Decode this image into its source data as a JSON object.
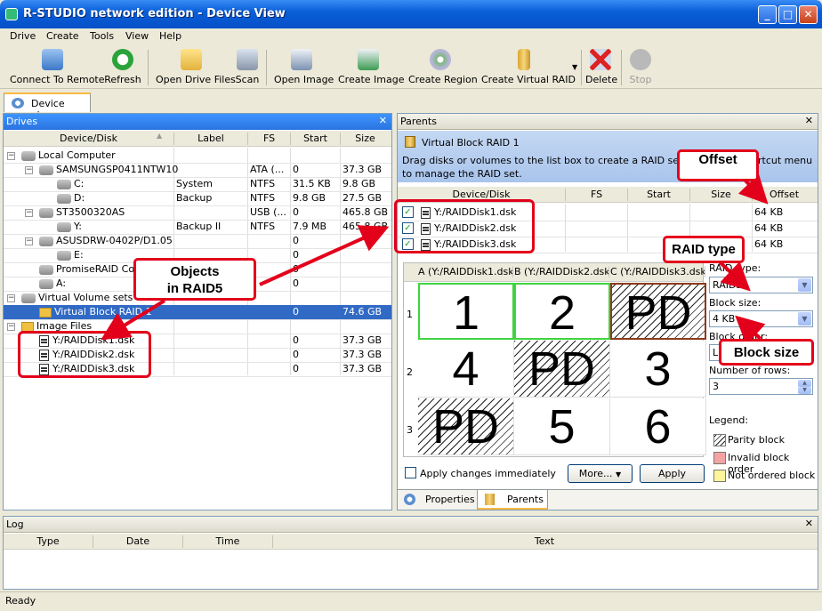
{
  "window": {
    "title": "R-STUDIO network edition - Device View"
  },
  "menu": [
    "Drive",
    "Create",
    "Tools",
    "View",
    "Help"
  ],
  "toolbar": {
    "connect": "Connect To Remote",
    "refresh": "Refresh",
    "open_drive_files": "Open Drive Files",
    "scan": "Scan",
    "open_image": "Open Image",
    "create_image": "Create Image",
    "create_region": "Create Region",
    "create_virtual_raid": "Create Virtual RAID",
    "delete": "Delete",
    "stop": "Stop"
  },
  "tabs": {
    "device_view": "Device view"
  },
  "drives": {
    "title": "Drives",
    "columns": [
      "Device/Disk",
      "Label",
      "FS",
      "Start",
      "Size"
    ],
    "rows": [
      {
        "name": "Local Computer",
        "label": "",
        "fs": "",
        "start": "",
        "size": ""
      },
      {
        "name": "SAMSUNGSP0411NTW10",
        "label": "",
        "fs": "ATA (...",
        "start": "0",
        "size": "37.3 GB"
      },
      {
        "name": "C:",
        "label": "System",
        "fs": "NTFS",
        "start": "31.5 KB",
        "size": "9.8 GB"
      },
      {
        "name": "D:",
        "label": "Backup",
        "fs": "NTFS",
        "start": "9.8 GB",
        "size": "27.5 GB"
      },
      {
        "name": "ST3500320AS",
        "label": "",
        "fs": "USB (...",
        "start": "0",
        "size": "465.8 GB"
      },
      {
        "name": "Y:",
        "label": "Backup II",
        "fs": "NTFS",
        "start": "7.9 MB",
        "size": "465.8 GB"
      },
      {
        "name": "ASUSDRW-0402P/D1.05",
        "label": "",
        "fs": "",
        "start": "0",
        "size": ""
      },
      {
        "name": "E:",
        "label": "",
        "fs": "",
        "start": "0",
        "size": ""
      },
      {
        "name": "PromiseRAID Co",
        "label": "",
        "fs": "",
        "start": "0",
        "size": ""
      },
      {
        "name": "A:",
        "label": "",
        "fs": "",
        "start": "0",
        "size": ""
      },
      {
        "name": "Virtual Volume sets and R",
        "label": "",
        "fs": "",
        "start": "",
        "size": ""
      },
      {
        "name": "Virtual Block RAID 1",
        "label": "",
        "fs": "",
        "start": "0",
        "size": "74.6 GB"
      },
      {
        "name": "Image Files",
        "label": "",
        "fs": "",
        "start": "",
        "size": ""
      },
      {
        "name": "Y:/RAIDDisk1.dsk",
        "label": "",
        "fs": "",
        "start": "0",
        "size": "37.3 GB"
      },
      {
        "name": "Y:/RAIDDisk2.dsk",
        "label": "",
        "fs": "",
        "start": "0",
        "size": "37.3 GB"
      },
      {
        "name": "Y:/RAIDDisk3.dsk",
        "label": "",
        "fs": "",
        "start": "0",
        "size": "37.3 GB"
      }
    ]
  },
  "parents": {
    "title": "Parents",
    "set_name": "Virtual Block RAID 1",
    "hint1": "Drag disks or volumes to the list box to create a RAID set. Also y",
    "hint1b": "rtcut menu",
    "hint2": "to manage the RAID set.",
    "columns": [
      "Device/Disk",
      "FS",
      "Start",
      "Size",
      "Offset"
    ],
    "rows": [
      {
        "name": "Y:/RAIDDisk1.dsk",
        "offset": "64 KB"
      },
      {
        "name": "Y:/RAIDDisk2.dsk",
        "offset": "64 KB"
      },
      {
        "name": "Y:/RAIDDisk3.dsk",
        "offset": "64 KB"
      }
    ],
    "grid_cols": [
      "A (Y:/RAIDDisk1.dsk)",
      "B (Y:/RAIDDisk2.dsk)",
      "C (Y:/RAIDDisk3.dsk)"
    ],
    "grid_rows": [
      "1",
      "2",
      "3"
    ],
    "blocks": [
      [
        "1",
        "2",
        "PD"
      ],
      [
        "4",
        "PD",
        "3"
      ],
      [
        "PD",
        "5",
        "6"
      ]
    ],
    "raid_type_label": "RAID type:",
    "raid_type": "RAID5",
    "block_size_label": "Block size:",
    "block_size": "4 KB",
    "block_order_label": "Block order:",
    "block_order": "L",
    "num_rows_label": "Number of rows:",
    "num_rows": "3",
    "legend_label": "Legend:",
    "legend": [
      "Parity block",
      "Invalid block order",
      "Not ordered block"
    ],
    "apply_changes": "Apply changes immediately",
    "more": "More...",
    "apply": "Apply",
    "bottom_tabs": [
      "Properties",
      "Parents"
    ]
  },
  "log": {
    "title": "Log",
    "columns": [
      "Type",
      "Date",
      "Time",
      "Text"
    ]
  },
  "status": "Ready",
  "annotations": {
    "objects": "Objects\nin RAID5",
    "offset": "Offset",
    "raid_type": "RAID type",
    "block_size": "Block size"
  },
  "colors": {
    "title_blue": "#0a5fd8",
    "panel_header": "#3d95ff",
    "annotation_red": "#e3001b",
    "selection": "#316ac5"
  }
}
